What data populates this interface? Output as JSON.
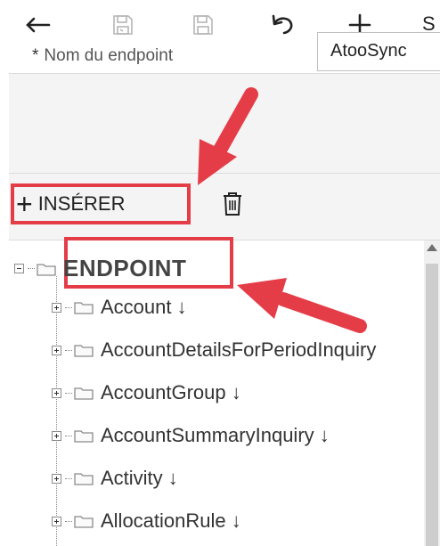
{
  "toolbar": {
    "back_icon": "arrow-left-icon",
    "save_disabled_icon": "save-disabled-icon",
    "save_icon": "save-icon",
    "undo_icon": "undo-icon",
    "add_icon": "plus-icon",
    "truncated_label": "S"
  },
  "form": {
    "required_marker": "*",
    "endpoint_name_label": "Nom du endpoint",
    "endpoint_name_value": "AtooSync"
  },
  "tree_toolbar": {
    "insert_label": "INSÉRER",
    "delete_icon": "trash-icon"
  },
  "tree": {
    "root": "ENDPOINT",
    "items": [
      {
        "label": "Account ↓"
      },
      {
        "label": "AccountDetailsForPeriodInquiry"
      },
      {
        "label": "AccountGroup ↓"
      },
      {
        "label": "AccountSummaryInquiry ↓"
      },
      {
        "label": "Activity ↓"
      },
      {
        "label": "AllocationRule ↓"
      }
    ]
  },
  "colors": {
    "highlight": "#e53d48",
    "panel_bg": "#f4f4f4",
    "folder_stroke": "#8a8a8a"
  }
}
